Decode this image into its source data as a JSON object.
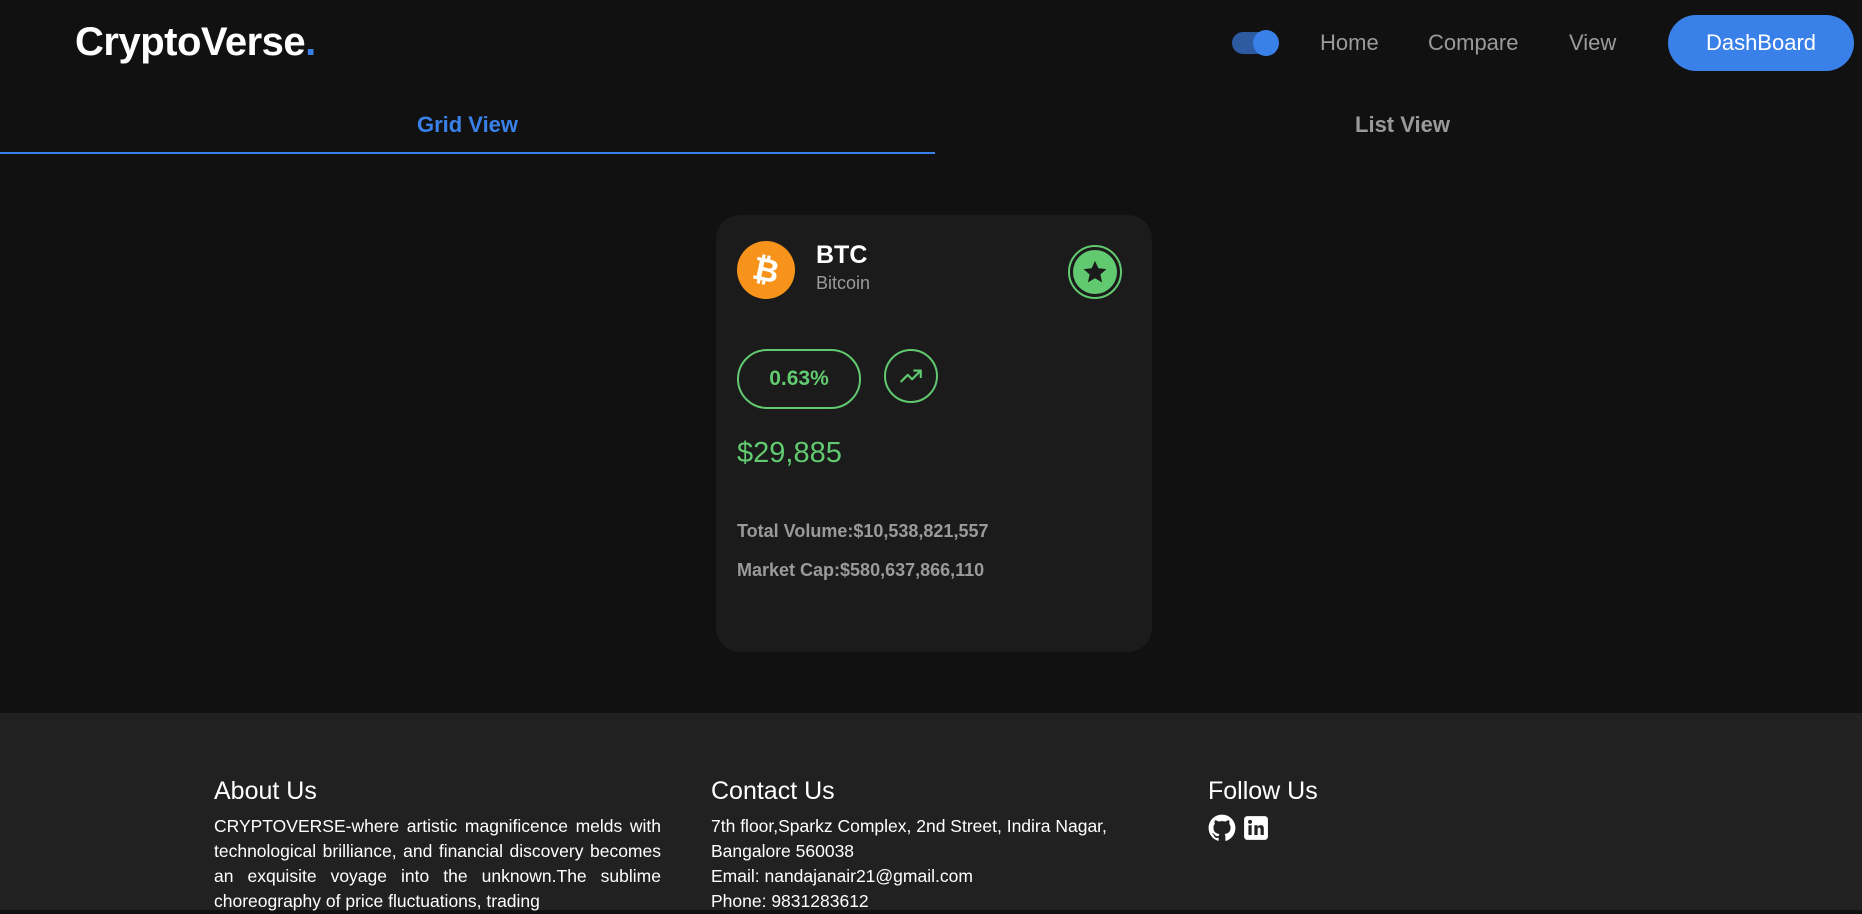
{
  "header": {
    "logo_text": "CryptoVerse",
    "logo_dot": ".",
    "nav": {
      "home": "Home",
      "compare": "Compare",
      "view": "View"
    },
    "dashboard_label": "DashBoard",
    "theme_toggle": "on"
  },
  "tabs": {
    "grid": "Grid View",
    "list": "List View",
    "active": "grid"
  },
  "coin_card": {
    "symbol": "BTC",
    "name": "Bitcoin",
    "change_pct": "0.63%",
    "price": "$29,885",
    "volume_label": "Total Volume:",
    "volume_value": "$10,538,821,557",
    "market_cap_label": "Market Cap:",
    "market_cap_value": "$580,637,866,110",
    "icons": {
      "coin": "bitcoin-icon",
      "favorite": "star-icon",
      "trend": "trending-up-icon"
    }
  },
  "footer": {
    "about": {
      "title": "About Us",
      "text": "CRYPTOVERSE-where artistic magnificence melds with technological brilliance, and financial discovery becomes an exquisite voyage into the unknown.The sublime choreography of price fluctuations, trading"
    },
    "contact": {
      "title": "Contact Us",
      "address": "7th floor,Sparkz Complex, 2nd Street, Indira Nagar, Bangalore 560038",
      "email": "Email: nandajanair21@gmail.com",
      "phone": "Phone: 9831283612"
    },
    "follow": {
      "title": "Follow Us",
      "icons": [
        "github-icon",
        "linkedin-icon"
      ]
    }
  },
  "colors": {
    "accent": "#3a80e9",
    "positive": "#61c96f",
    "bitcoin": "#f7931a",
    "background": "#111111",
    "card": "#1b1b1b",
    "footer": "#212121",
    "muted": "#9a9a9a"
  }
}
